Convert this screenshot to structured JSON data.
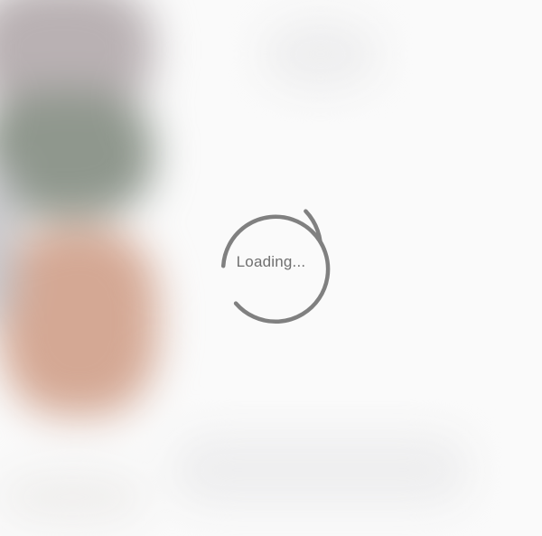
{
  "loading": {
    "label": "Loading..."
  },
  "colors": {
    "spinner": "#808080",
    "label": "#6f6f6f",
    "background": "#fafafa"
  },
  "icons": {
    "spinner": "loading-spinner-icon"
  }
}
